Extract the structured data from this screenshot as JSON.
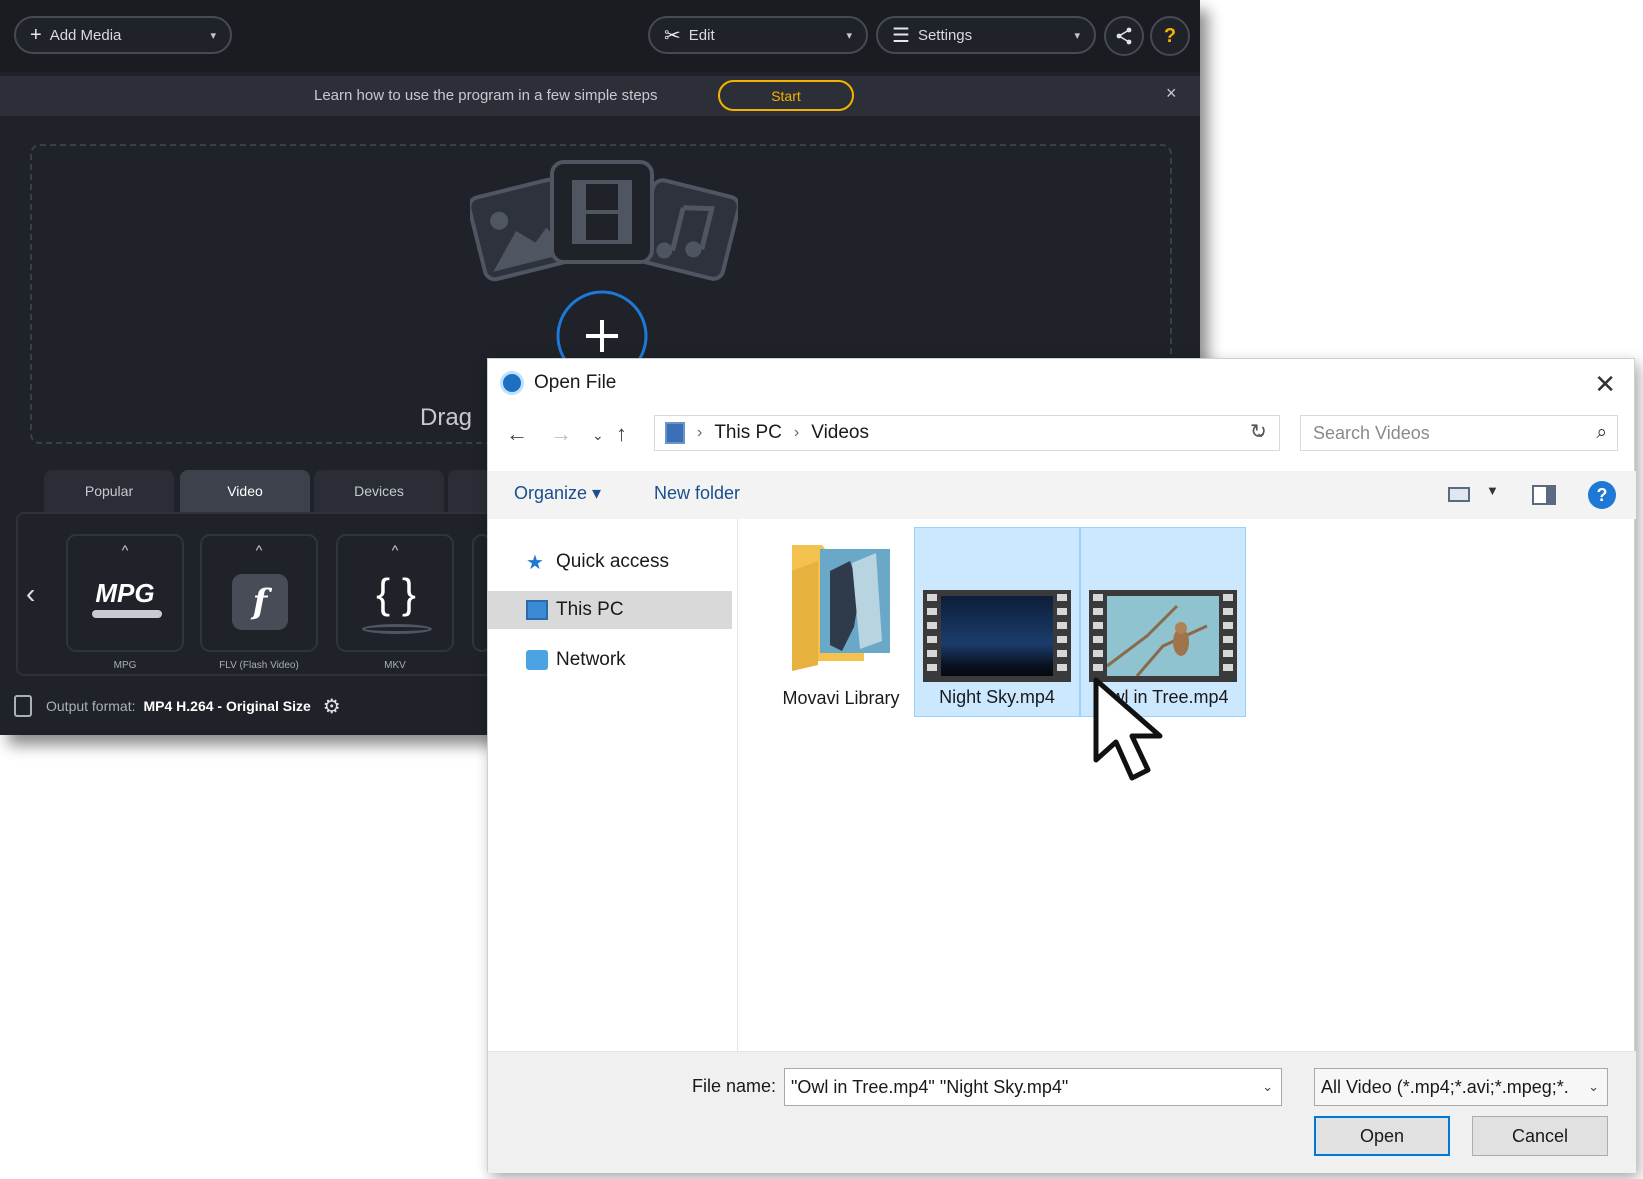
{
  "app": {
    "add_media": "Add Media",
    "edit": "Edit",
    "settings": "Settings",
    "help": "?",
    "banner_text": "Learn how to use the program in a few simple steps",
    "start": "Start",
    "close": "×",
    "drop_text": "Drag",
    "tabs": [
      "Popular",
      "Video",
      "Devices"
    ],
    "active_tab": "Video",
    "formats": [
      {
        "label": "MPG",
        "icon_text": "MPG"
      },
      {
        "label": "FLV (Flash Video)",
        "icon_text": "f"
      },
      {
        "label": "MKV",
        "icon_text": "{ }"
      }
    ],
    "output_label": "Output format:",
    "output_value": "MP4 H.264 - Original Size"
  },
  "dialog": {
    "title": "Open File",
    "path": [
      "This PC",
      "Videos"
    ],
    "search_placeholder": "Search Videos",
    "organize": "Organize",
    "new_folder": "New folder",
    "nav": [
      "Quick access",
      "This PC",
      "Network"
    ],
    "selected_nav": "This PC",
    "files": [
      {
        "name": "Movavi Library",
        "type": "folder",
        "selected": false
      },
      {
        "name": "Night Sky.mp4",
        "type": "video",
        "selected": true
      },
      {
        "name": "Owl in Tree.mp4",
        "type": "video",
        "selected": true
      }
    ],
    "file_name_label": "File name:",
    "file_name_value": "\"Owl in Tree.mp4\" \"Night Sky.mp4\"",
    "filter": "All Video (*.mp4;*.avi;*.mpeg;*.",
    "open": "Open",
    "cancel": "Cancel"
  },
  "colors": {
    "accent": "#f5b301",
    "selection": "#cce8ff",
    "link": "#1a4f8b"
  }
}
